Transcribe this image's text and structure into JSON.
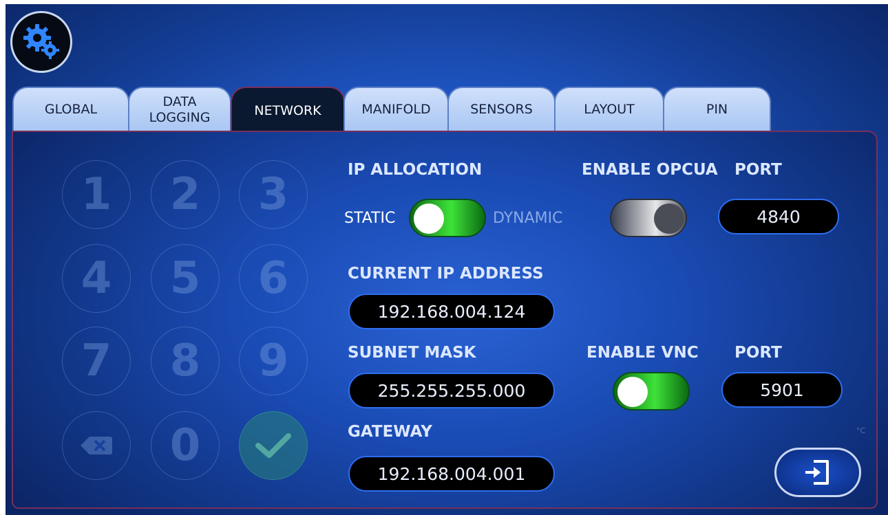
{
  "tabs": [
    {
      "label": "GLOBAL"
    },
    {
      "label": "DATA\nLOGGING"
    },
    {
      "label": "NETWORK",
      "active": true
    },
    {
      "label": "MANIFOLD"
    },
    {
      "label": "SENSORS"
    },
    {
      "label": "LAYOUT"
    },
    {
      "label": "PIN"
    }
  ],
  "keypad": {
    "keys": [
      "1",
      "2",
      "3",
      "4",
      "5",
      "6",
      "7",
      "8",
      "9",
      "backspace",
      "0",
      "confirm"
    ],
    "icons": {
      "backspace": "backspace-icon",
      "confirm": "checkmark-icon"
    }
  },
  "network": {
    "ip_allocation_label": "IP ALLOCATION",
    "static_label": "STATIC",
    "dynamic_label": "DYNAMIC",
    "ip_allocation_dynamic": true,
    "enable_opcua_label": "ENABLE OPCUA",
    "opcua_enabled": false,
    "opcua_port_label": "PORT",
    "opcua_port": "4840",
    "current_ip_label": "CURRENT IP ADDRESS",
    "current_ip": "192.168.004.124",
    "subnet_label": "SUBNET MASK",
    "subnet_mask": "255.255.255.000",
    "enable_vnc_label": "ENABLE VNC",
    "vnc_enabled": true,
    "vnc_port_label": "PORT",
    "vnc_port": "5901",
    "gateway_label": "GATEWAY",
    "gateway": "192.168.004.001"
  },
  "unit_mark": "°C",
  "icons": {
    "settings": "gears-icon",
    "exit": "exit-icon"
  },
  "colors": {
    "toggle_on": "#3ee23a",
    "field_border": "#2e6ef0",
    "active_tab": "#0a1830"
  }
}
